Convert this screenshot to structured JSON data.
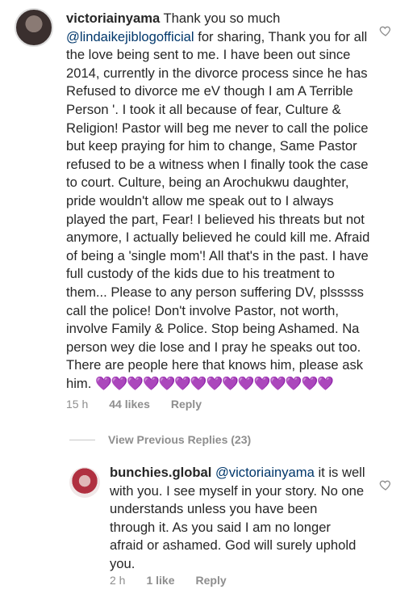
{
  "main_comment": {
    "username": "victoriainyama",
    "text_pre": " Thank you so much ",
    "mention": "@lindaikejiblogofficial",
    "text_post": " for sharing,  Thank you for all the love being sent to me.  I have been out since 2014, currently in the divorce process since he has Refused to divorce me eV though I am A Terrible Person '. I took it all because of fear, Culture & Religion!  Pastor will beg me never to call the police but keep praying for him to change,  Same Pastor refused to be a witness when I finally took the case to court. Culture,  being an Arochukwu daughter,  pride wouldn't allow me speak out to I always played the part, Fear! I believed his threats but not anymore,  I actually believed he could kill me. Afraid of being a 'single mom'! All that's in the past.  I have full custody of the kids due to his treatment to them... Please to any person suffering DV, plsssss call the police!  Don't involve Pastor,  not worth,  involve Family & Police.  Stop being Ashamed.  Na person wey die lose and I pray he speaks out too.  There are people here that knows him, please ask him. ",
    "hearts": "💜💜💜💜💜💜💜💜💜💜💜💜💜💜💜",
    "time": "15 h",
    "likes": "44 likes",
    "reply_label": "Reply"
  },
  "view_replies_label": "View Previous Replies (23)",
  "reply_comment": {
    "username": "bunchies.global",
    "mention": "@victoriainyama",
    "text_post": " it is well with you. I see myself in your story. No one understands unless you have been through it. As you said I am no longer afraid or ashamed.  God will surely uphold you.",
    "time": "2 h",
    "likes": "1 like",
    "reply_label": "Reply"
  },
  "icons": {
    "like": "heart-outline-icon"
  },
  "colors": {
    "mention": "#00376b",
    "meta": "#8e8e8e",
    "hearts": "#9b30d9"
  }
}
